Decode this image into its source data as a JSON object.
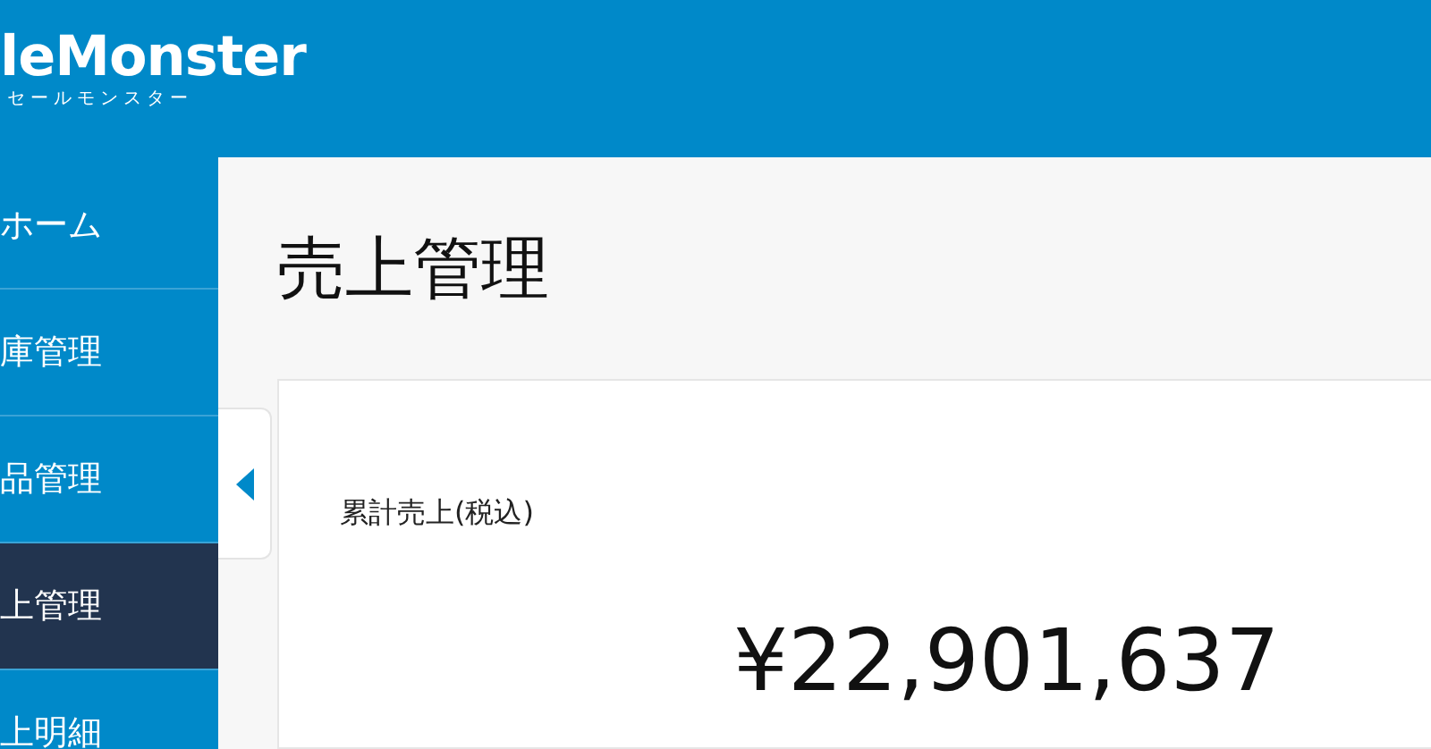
{
  "header": {
    "logo": "leMonster",
    "logo_subtitle": "セールモンスター"
  },
  "sidebar": {
    "items": [
      {
        "label": "ホーム",
        "selected": false
      },
      {
        "label": "庫管理",
        "selected": false
      },
      {
        "label": "品管理",
        "selected": false
      },
      {
        "label": "上管理",
        "selected": true
      },
      {
        "label": "上明細",
        "selected": false
      }
    ]
  },
  "page_title": "売上管理",
  "card": {
    "label": "累計売上(税込)",
    "amount": "¥22,901,637"
  }
}
